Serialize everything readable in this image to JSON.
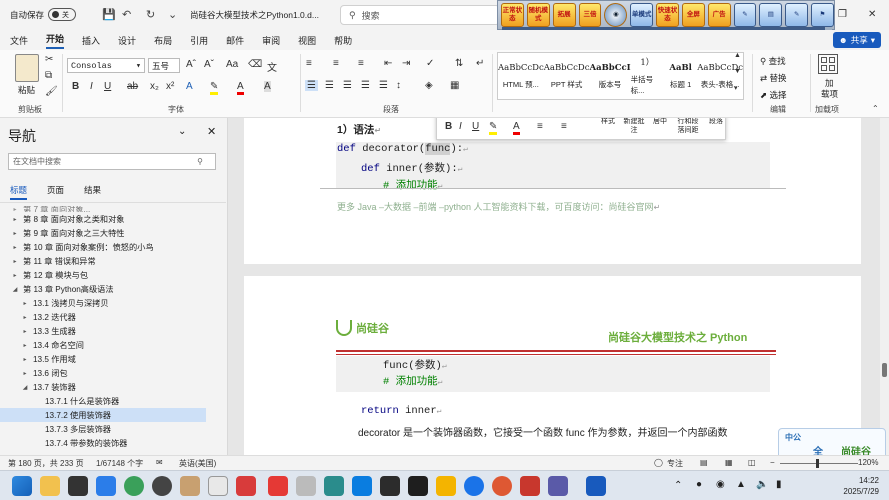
{
  "titlebar": {
    "autosave_label": "自动保存",
    "autosave_state": "关",
    "doc_title": "尚硅谷大模型技术之Python1.0.d...",
    "search_label": "搜索",
    "ext_buttons": [
      "正常状态",
      "随机模式",
      "拓展",
      "三倍",
      "",
      "单模式",
      "快速状态",
      "全屏",
      "广告",
      "",
      "",
      "",
      ""
    ],
    "ext_progress": 0.98
  },
  "menu": {
    "items": [
      "文件",
      "开始",
      "插入",
      "设计",
      "布局",
      "引用",
      "邮件",
      "审阅",
      "视图",
      "帮助"
    ],
    "active": "开始",
    "share_label": "共享"
  },
  "ribbon": {
    "paste_label": "粘贴",
    "clipboard_label": "剪贴板",
    "font_name": "Consolas",
    "font_size": "五号",
    "font_label": "字体",
    "paragraph_label": "段落",
    "styles": [
      {
        "sample": "AaBbCcDc",
        "name": "HTML 预..."
      },
      {
        "sample": "AaBbCcDc",
        "name": "PPT 样式"
      },
      {
        "sample": "AaBbCcI",
        "name": "版本号"
      },
      {
        "sample": "1）",
        "name": "半括号标..."
      },
      {
        "sample": "AaBl",
        "name": "标题 1"
      },
      {
        "sample": "AaBbCcDc",
        "name": "表头-表格..."
      }
    ],
    "editing": {
      "find": "查找",
      "replace": "替换",
      "select": "选择",
      "label": "编辑"
    },
    "addin": {
      "line1": "加",
      "line2": "载项",
      "label": "加载项"
    }
  },
  "nav": {
    "title": "导航",
    "search_placeholder": "在文档中搜索",
    "tabs": [
      "标题",
      "页面",
      "结果"
    ],
    "items": [
      {
        "text": "第 7 章 面向对象...",
        "level": 0,
        "arrow": "▸"
      },
      {
        "text": "第 8 章 面向对象之类和对象",
        "level": 0,
        "arrow": "▸"
      },
      {
        "text": "第 9 章 面向对象之三大特性",
        "level": 0,
        "arrow": "▸"
      },
      {
        "text": "第 10 章 面向对象案例：愤怒的小鸟",
        "level": 0,
        "arrow": "▸"
      },
      {
        "text": "第 11 章 错误和异常",
        "level": 0,
        "arrow": "▸"
      },
      {
        "text": "第 12 章 模块与包",
        "level": 0,
        "arrow": "▸"
      },
      {
        "text": "第 13 章 Python高级语法",
        "level": 0,
        "arrow": "◢"
      },
      {
        "text": "13.1 浅拷贝与深拷贝",
        "level": 1,
        "arrow": "▸"
      },
      {
        "text": "13.2 迭代器",
        "level": 1,
        "arrow": "▸"
      },
      {
        "text": "13.3 生成器",
        "level": 1,
        "arrow": "▸"
      },
      {
        "text": "13.4 命名空间",
        "level": 1,
        "arrow": "▸"
      },
      {
        "text": "13.5 作用域",
        "level": 1,
        "arrow": "▸"
      },
      {
        "text": "13.6 闭包",
        "level": 1,
        "arrow": "▸"
      },
      {
        "text": "13.7 装饰器",
        "level": 1,
        "arrow": "◢"
      },
      {
        "text": "13.7.1 什么是装饰器",
        "level": 2,
        "arrow": ""
      },
      {
        "text": "13.7.2 使用装饰器",
        "level": 2,
        "arrow": "",
        "selected": true
      },
      {
        "text": "13.7.3 多层装饰器",
        "level": 2,
        "arrow": ""
      },
      {
        "text": "13.7.4 带参数的装饰器",
        "level": 2,
        "arrow": ""
      }
    ]
  },
  "doc": {
    "heading": "1）语法",
    "code1": {
      "kw": "def",
      "name": " decorator(",
      "hl": "func",
      "end": "):"
    },
    "code2": {
      "kw": "def",
      "name": " inner(参数):"
    },
    "code3": "# 添加功能",
    "footer_text": "更多 Java –大数据 –前端 –python 人工智能资料下载，可百度访问：尚硅谷官网",
    "logo_text": "尚硅谷",
    "banner_text": "尚硅谷大模型技术之 Python",
    "code4": "func(参数)",
    "code5": "# 添加功能",
    "code6_kw": "return",
    "code6_rest": " inner",
    "body_text": "decorator 是一个装饰器函数，它接受一个函数 func 作为参数，并返回一个内部函数"
  },
  "mini_toolbar": {
    "font": "Consolas",
    "size": "五号",
    "items": [
      "样式",
      "新建批注",
      "居中",
      "行和段落间距",
      "段落"
    ]
  },
  "status": {
    "page": "第 180 页，共 233 页",
    "words": "1/67148 个字",
    "lang": "英语(美国)",
    "focus": "专注",
    "zoom": "120%"
  },
  "clock": {
    "time": "14:22",
    "date": "2025/7/29"
  },
  "corner_logo": {
    "left": "中公",
    "right": "全",
    "brand": "尚硅谷"
  }
}
